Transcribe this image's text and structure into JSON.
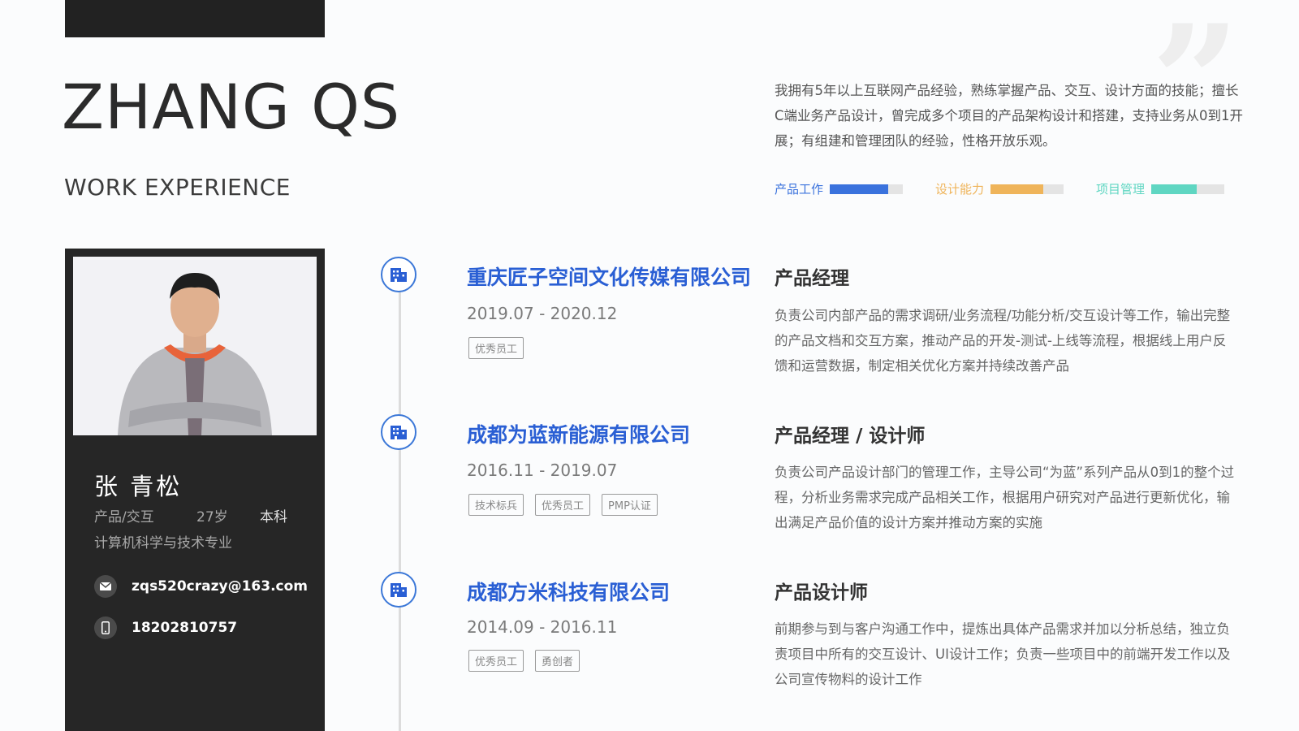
{
  "header": {
    "name_en": "ZHANG QS",
    "subtitle": "WORK EXPERIENCE",
    "intro": "我拥有5年以上互联网产品经验，熟练掌握产品、交互、设计方面的技能；擅长C端业务产品设计，曾完成多个项目的产品架构设计和搭建，支持业务从0到1开展；有组建和管理团队的经验，性格开放乐观。"
  },
  "skills": [
    {
      "label": "产品工作",
      "level": 0.8,
      "color": "#3a72dd"
    },
    {
      "label": "设计能力",
      "level": 0.72,
      "color": "#efb45a"
    },
    {
      "label": "项目管理",
      "level": 0.62,
      "color": "#5fd6c2"
    }
  ],
  "profile": {
    "name_cn": "张 青松",
    "position": "产品/交互",
    "age": "27岁",
    "degree": "本科",
    "major": "计算机科学与技术专业",
    "email": "zqs520crazy@163.com",
    "phone": "18202810757"
  },
  "experiences": [
    {
      "company": "重庆匠子空间文化传媒有限公司",
      "period": "2019.07 - 2020.12",
      "tags": [
        "优秀员工"
      ],
      "role": "产品经理",
      "description": "负责公司内部产品的需求调研/业务流程/功能分析/交互设计等工作，输出完整的产品文档和交互方案，推动产品的开发-测试-上线等流程，根据线上用户反馈和运营数据，制定相关优化方案并持续改善产品"
    },
    {
      "company": "成都为蓝新能源有限公司",
      "period": "2016.11 - 2019.07",
      "tags": [
        "技术标兵",
        "优秀员工",
        "PMP认证"
      ],
      "role": "产品经理 / 设计师",
      "description": "负责公司产品设计部门的管理工作，主导公司“为蓝”系列产品从0到1的整个过程，分析业务需求完成产品相关工作，根据用户研究对产品进行更新优化，输出满足产品价值的设计方案并推动方案的实施"
    },
    {
      "company": "成都方米科技有限公司",
      "period": "2014.09 - 2016.11",
      "tags": [
        "优秀员工",
        "勇创者"
      ],
      "role": "产品设计师",
      "description": "前期参与到与客户沟通工作中，提炼出具体产品需求并加以分析总结，独立负责项目中所有的交互设计、UI设计工作；负责一些项目中的前端开发工作以及公司宣传物料的设计工作"
    }
  ]
}
